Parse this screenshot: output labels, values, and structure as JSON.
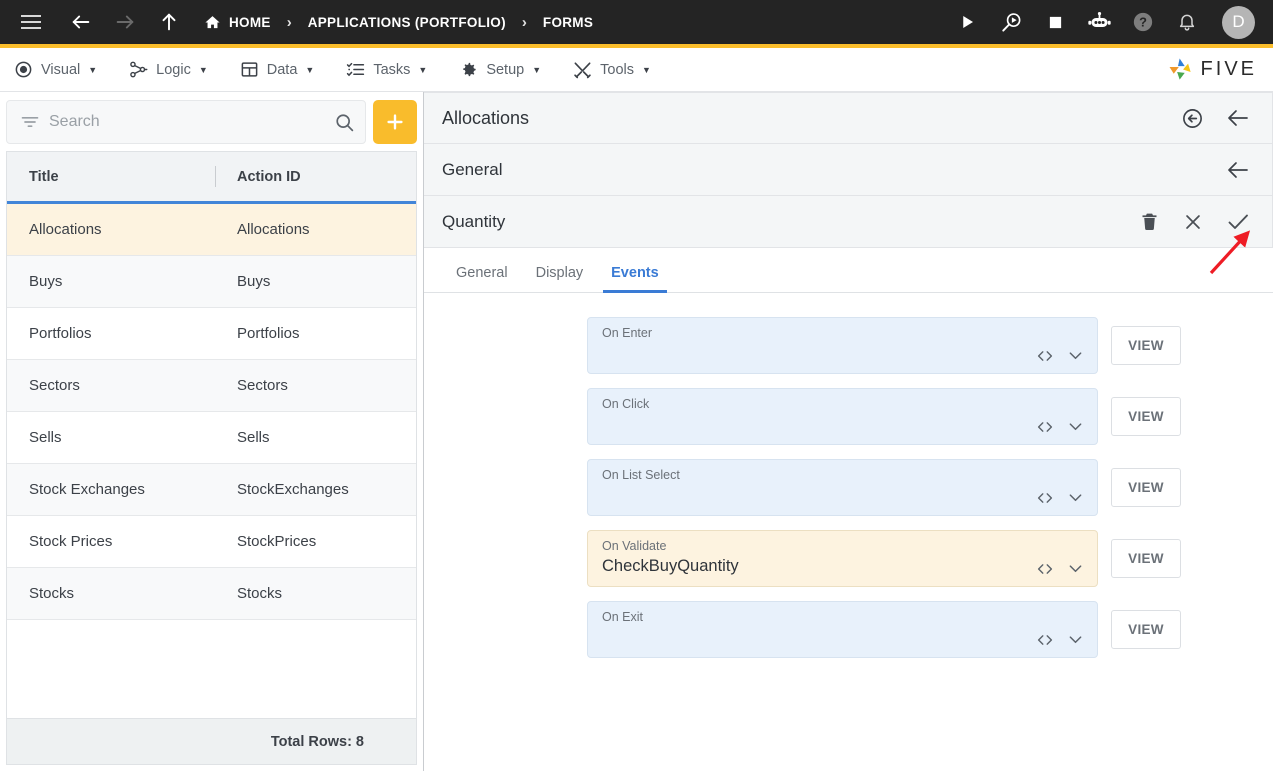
{
  "header": {
    "nav": {
      "menu_icon": "hamburger-icon",
      "back_icon": "arrow-left-icon",
      "forward_icon": "arrow-right-icon",
      "up_icon": "arrow-up-icon"
    },
    "breadcrumbs": [
      {
        "label": "HOME",
        "icon": "home-icon"
      },
      {
        "label": "APPLICATIONS (PORTFOLIO)",
        "icon": ""
      },
      {
        "label": "FORMS",
        "icon": ""
      }
    ],
    "separator": "›",
    "actions": [
      {
        "name": "run-icon",
        "title": "Run"
      },
      {
        "name": "debug-icon",
        "title": "Debug"
      },
      {
        "name": "stop-icon",
        "title": "Stop"
      },
      {
        "name": "chatbot-icon",
        "title": "Assistant"
      },
      {
        "name": "help-icon",
        "title": "Help"
      },
      {
        "name": "notifications-icon",
        "title": "Notifications"
      }
    ],
    "avatar_initial": "D",
    "accent_color": "#FBBE2C"
  },
  "menubar": {
    "items": [
      {
        "label": "Visual",
        "icon": "eye-icon"
      },
      {
        "label": "Logic",
        "icon": "flow-nodes-icon"
      },
      {
        "label": "Data",
        "icon": "grid-table-icon"
      },
      {
        "label": "Tasks",
        "icon": "checklist-icon"
      },
      {
        "label": "Setup",
        "icon": "gear-icon"
      },
      {
        "label": "Tools",
        "icon": "wrench-screwdriver-icon"
      }
    ],
    "caret": "▼",
    "brand": "FIVE"
  },
  "left_panel": {
    "search": {
      "placeholder": "Search",
      "value": "",
      "filter_icon": "filter-icon",
      "search_icon": "search-icon"
    },
    "add_button_label": "+",
    "table": {
      "columns": [
        "Title",
        "Action ID"
      ],
      "rows": [
        {
          "title": "Allocations",
          "action_id": "Allocations",
          "selected": true
        },
        {
          "title": "Buys",
          "action_id": "Buys",
          "selected": false
        },
        {
          "title": "Portfolios",
          "action_id": "Portfolios",
          "selected": false
        },
        {
          "title": "Sectors",
          "action_id": "Sectors",
          "selected": false
        },
        {
          "title": "Sells",
          "action_id": "Sells",
          "selected": false
        },
        {
          "title": "Stock Exchanges",
          "action_id": "StockExchanges",
          "selected": false
        },
        {
          "title": "Stock Prices",
          "action_id": "StockPrices",
          "selected": false
        },
        {
          "title": "Stocks",
          "action_id": "Stocks",
          "selected": false
        }
      ],
      "footer": "Total Rows: 8"
    }
  },
  "right_panel": {
    "header": {
      "title": "Allocations",
      "actions": [
        {
          "name": "revert-icon"
        },
        {
          "name": "back-icon"
        }
      ]
    },
    "section": {
      "title": "General",
      "actions": [
        {
          "name": "back-icon"
        }
      ]
    },
    "field": {
      "title": "Quantity",
      "actions": [
        {
          "name": "delete-icon"
        },
        {
          "name": "close-icon"
        },
        {
          "name": "save-icon"
        }
      ]
    },
    "tabs": [
      {
        "label": "General",
        "active": false
      },
      {
        "label": "Display",
        "active": false
      },
      {
        "label": "Events",
        "active": true
      }
    ],
    "events": [
      {
        "label": "On Enter",
        "value": "",
        "highlighted": false,
        "button": "VIEW"
      },
      {
        "label": "On Click",
        "value": "",
        "highlighted": false,
        "button": "VIEW"
      },
      {
        "label": "On List Select",
        "value": "",
        "highlighted": false,
        "button": "VIEW"
      },
      {
        "label": "On Validate",
        "value": "CheckBuyQuantity",
        "highlighted": true,
        "button": "VIEW"
      },
      {
        "label": "On Exit",
        "value": "",
        "highlighted": false,
        "button": "VIEW"
      }
    ],
    "field_icons": {
      "code": "code-brackets-icon",
      "dropdown": "chevron-down-icon"
    }
  },
  "annotation": {
    "type": "arrow",
    "color": "#ee1c25",
    "points_to": "save-icon"
  }
}
